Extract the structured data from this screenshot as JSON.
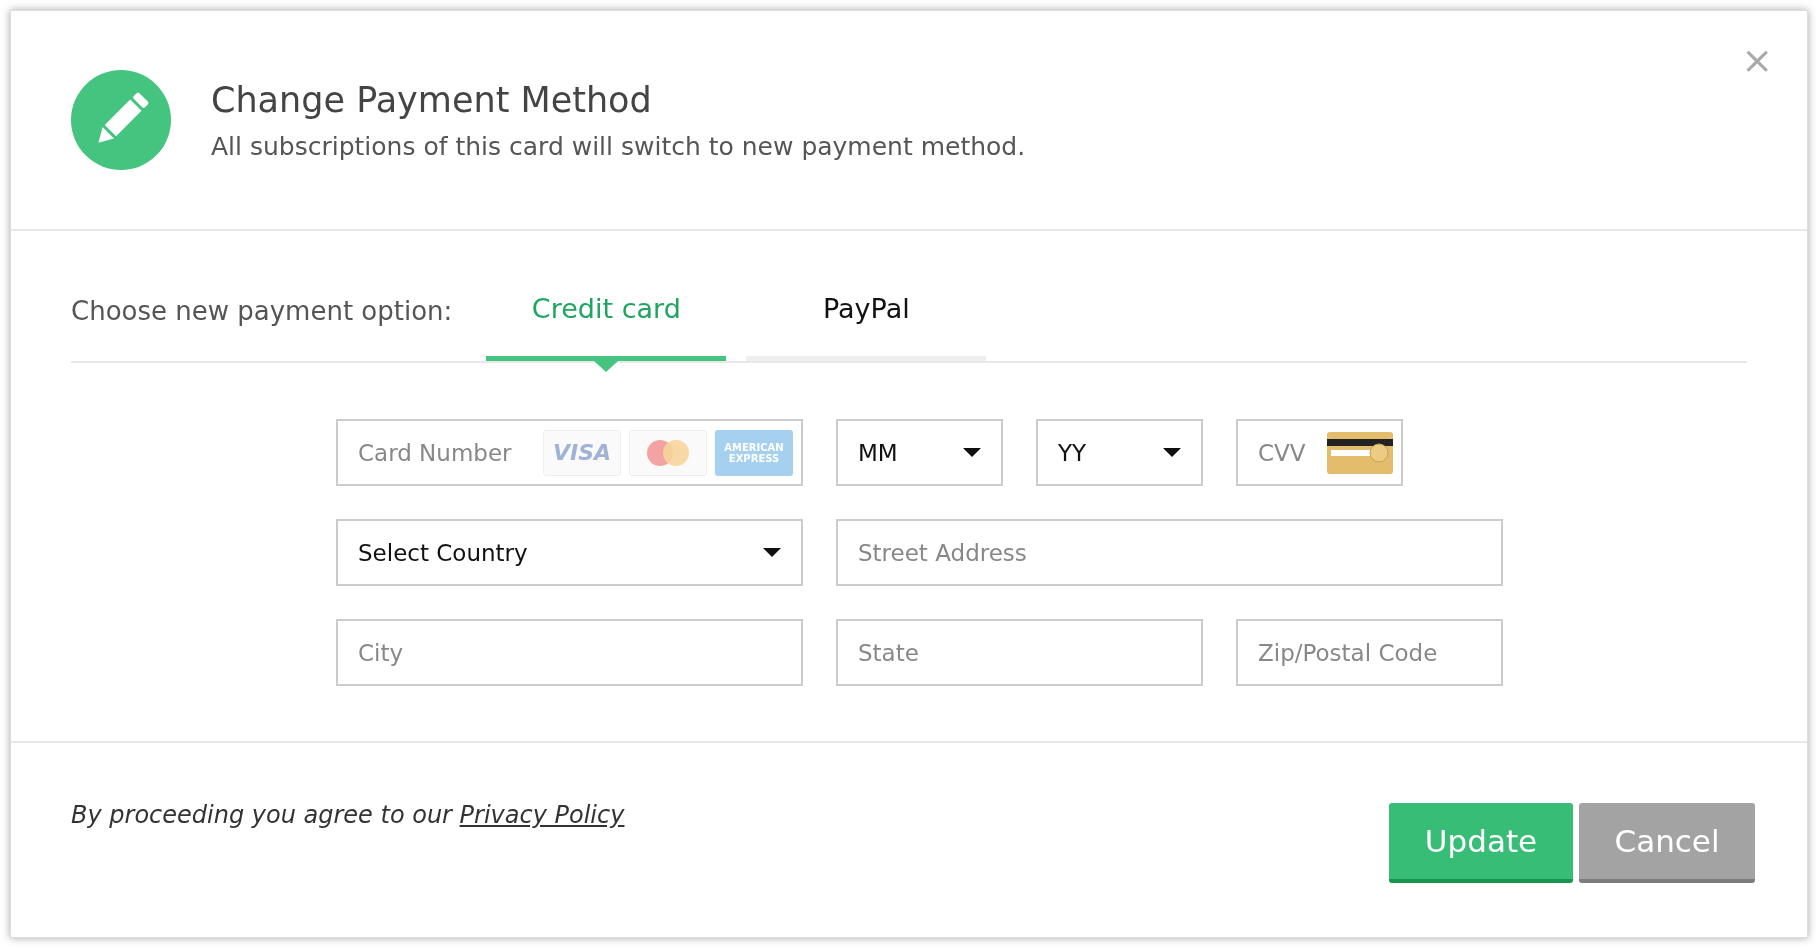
{
  "dialog": {
    "title": "Change Payment Method",
    "subtitle": "All subscriptions of this card will switch to new payment method.",
    "close": "×"
  },
  "payment_option": {
    "label": "Choose new payment option:",
    "tabs": [
      {
        "label": "Credit card",
        "selected": true
      },
      {
        "label": "PayPal",
        "selected": false
      }
    ]
  },
  "form_rows": [
    [
      {
        "kind": "card",
        "placeholder": "Card Number",
        "logos": [
          {
            "kind": "visa",
            "text": "VISA"
          },
          {
            "kind": "mastercard"
          },
          {
            "kind": "amex",
            "text": "AMERICAN EXPRESS"
          }
        ]
      },
      {
        "kind": "select",
        "value": "MM"
      },
      {
        "kind": "select",
        "value": "YY"
      },
      {
        "kind": "cvv",
        "placeholder": "CVV"
      }
    ],
    [
      {
        "kind": "select",
        "value": "Select Country"
      },
      {
        "kind": "text",
        "placeholder": "Street Address"
      }
    ],
    [
      {
        "kind": "text",
        "placeholder": "City"
      },
      {
        "kind": "text",
        "placeholder": "State"
      },
      {
        "kind": "text",
        "placeholder": "Zip/Postal Code"
      }
    ]
  ],
  "footer": {
    "notice": "By proceeding you agree to our",
    "link": "Privacy Policy",
    "buttons": [
      {
        "label": "Update",
        "kind": "primary"
      },
      {
        "label": "Cancel",
        "kind": "secondary"
      }
    ]
  }
}
